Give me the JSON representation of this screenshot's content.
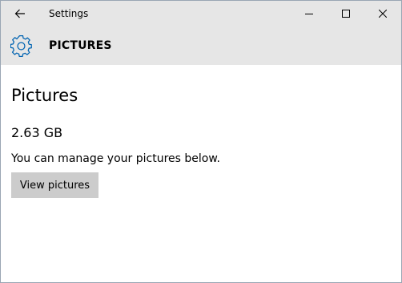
{
  "window": {
    "title": "Settings"
  },
  "header": {
    "title": "PICTURES"
  },
  "main": {
    "page_title": "Pictures",
    "size": "2.63 GB",
    "description": "You can manage your pictures below.",
    "view_button_label": "View pictures"
  },
  "icons": {
    "back": "back-arrow-icon",
    "minimize": "minimize-icon",
    "maximize": "maximize-icon",
    "close": "close-icon",
    "section": "gear-icon"
  },
  "colors": {
    "accent": "#0063b1",
    "titlebar": "#e6e6e6",
    "button": "#cccccc"
  }
}
